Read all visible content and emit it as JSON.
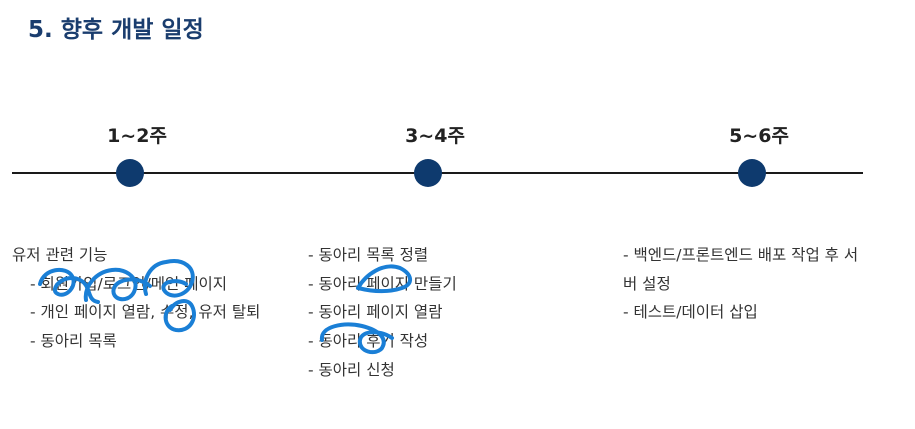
{
  "title": "5. 향후 개발 일정",
  "accent_color": "#1a3d6e",
  "milestone_color": "#0e3a6e",
  "annotation_color": "#1a7fd6",
  "milestones": [
    {
      "period": "1~2주",
      "heading": "유저 관련 기능",
      "items": [
        "- 회원가입/로그인/메인 페이지",
        "- 개인 페이지 열람, 수정, 유저 탈퇴",
        "- 동아리 목록"
      ]
    },
    {
      "period": "3~4주",
      "items": [
        "- 동아리 목록 정렬",
        "- 동아리 페이지 만들기",
        "- 동아리 페이지 열람",
        "- 동아리 후기 작성",
        "- 동아리 신청"
      ]
    },
    {
      "period": "5~6주",
      "items": [
        "- 백엔드/프론트엔드 배포 작업 후 서",
        "버 설정",
        "- 테스트/데이터 삽입"
      ]
    }
  ]
}
